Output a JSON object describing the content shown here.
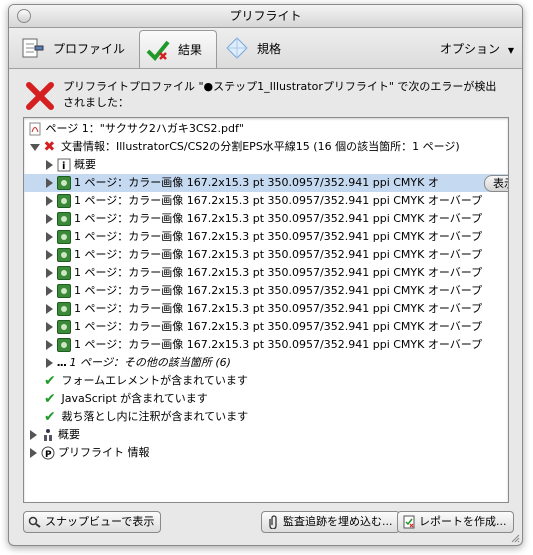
{
  "window": {
    "title": "プリフライト"
  },
  "toolbar": {
    "tabs": [
      {
        "label": "プロファイル",
        "icon": "profile-icon"
      },
      {
        "label": "結果",
        "icon": "checkmark-icon"
      },
      {
        "label": "規格",
        "icon": "diamond-icon"
      }
    ],
    "options_label": "オプション"
  },
  "error_header": {
    "line1": "プリフライトプロファイル \"●ステップ1_Illustratorプリフライト\" で次のエラーが検出",
    "line2": "されました："
  },
  "tree": {
    "page_label": "ページ 1：\"サクサク2ハガキ3CS2.pdf\"",
    "doc_info_label": "文書情報：IllustratorCS/CS2の分割EPS水平線15 (16 個の該当箇所：1 ページ)",
    "overview_label": "概要",
    "image_rows": [
      "1 ページ：カラー画像 167.2x15.3 pt 350.0957/352.941 ppi CMYK オ",
      "1 ページ：カラー画像 167.2x15.3 pt 350.0957/352.941 ppi CMYK オーバープ",
      "1 ページ：カラー画像 167.2x15.3 pt 350.0957/352.941 ppi CMYK オーバープ",
      "1 ページ：カラー画像 167.2x15.3 pt 350.0957/352.941 ppi CMYK オーバープ",
      "1 ページ：カラー画像 167.2x15.3 pt 350.0957/352.941 ppi CMYK オーバープ",
      "1 ページ：カラー画像 167.2x15.3 pt 350.0957/352.941 ppi CMYK オーバープ",
      "1 ページ：カラー画像 167.2x15.3 pt 350.0957/352.941 ppi CMYK オーバープ",
      "1 ページ：カラー画像 167.2x15.3 pt 350.0957/352.941 ppi CMYK オーバープ",
      "1 ページ：カラー画像 167.2x15.3 pt 350.0957/352.941 ppi CMYK オーバープ",
      "1 ページ：カラー画像 167.2x15.3 pt 350.0957/352.941 ppi CMYK オーバープ"
    ],
    "show_button": "表示",
    "other_label": "1 ページ：その他の該当箇所 (6)",
    "check_items": [
      "フォームエレメントが含まれています",
      "JavaScript が含まれています",
      "裁ち落とし内に注釈が含まれています"
    ],
    "summary_label": "概要",
    "preflight_info_label": "プリフライト 情報"
  },
  "bottom": {
    "snap_view": "スナップビューで表示",
    "embed_audit": "監査追跡を埋め込む...",
    "create_report": "レポートを作成..."
  },
  "colors": {
    "error": "#d42020",
    "ok": "#1f9a2a",
    "selection": "#c5d9f1"
  }
}
